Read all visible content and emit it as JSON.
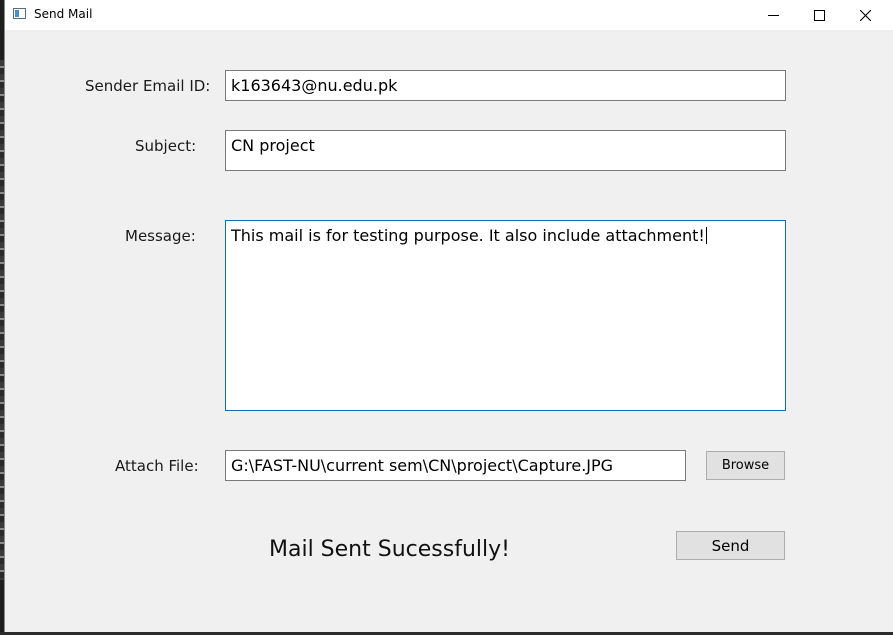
{
  "window": {
    "title": "Send Mail",
    "icon": "app-window-icon"
  },
  "window_controls": {
    "minimize_icon": "minimize-icon",
    "maximize_icon": "maximize-icon",
    "close_icon": "close-icon"
  },
  "form": {
    "sender_label": "Sender Email ID:",
    "sender_value": "k163643@nu.edu.pk",
    "subject_label": "Subject:",
    "subject_value": "CN project",
    "message_label": "Message:",
    "message_value": "This mail is for testing purpose. It also include attachment!",
    "attach_label": "Attach File:",
    "attach_value": "G:\\FAST-NU\\current sem\\CN\\project\\Capture.JPG",
    "browse_label": "Browse",
    "send_label": "Send"
  },
  "status": {
    "text": "Mail Sent Sucessfully!"
  },
  "colors": {
    "focus_border": "#0f6cbd",
    "window_bg": "#f0f0f0"
  }
}
